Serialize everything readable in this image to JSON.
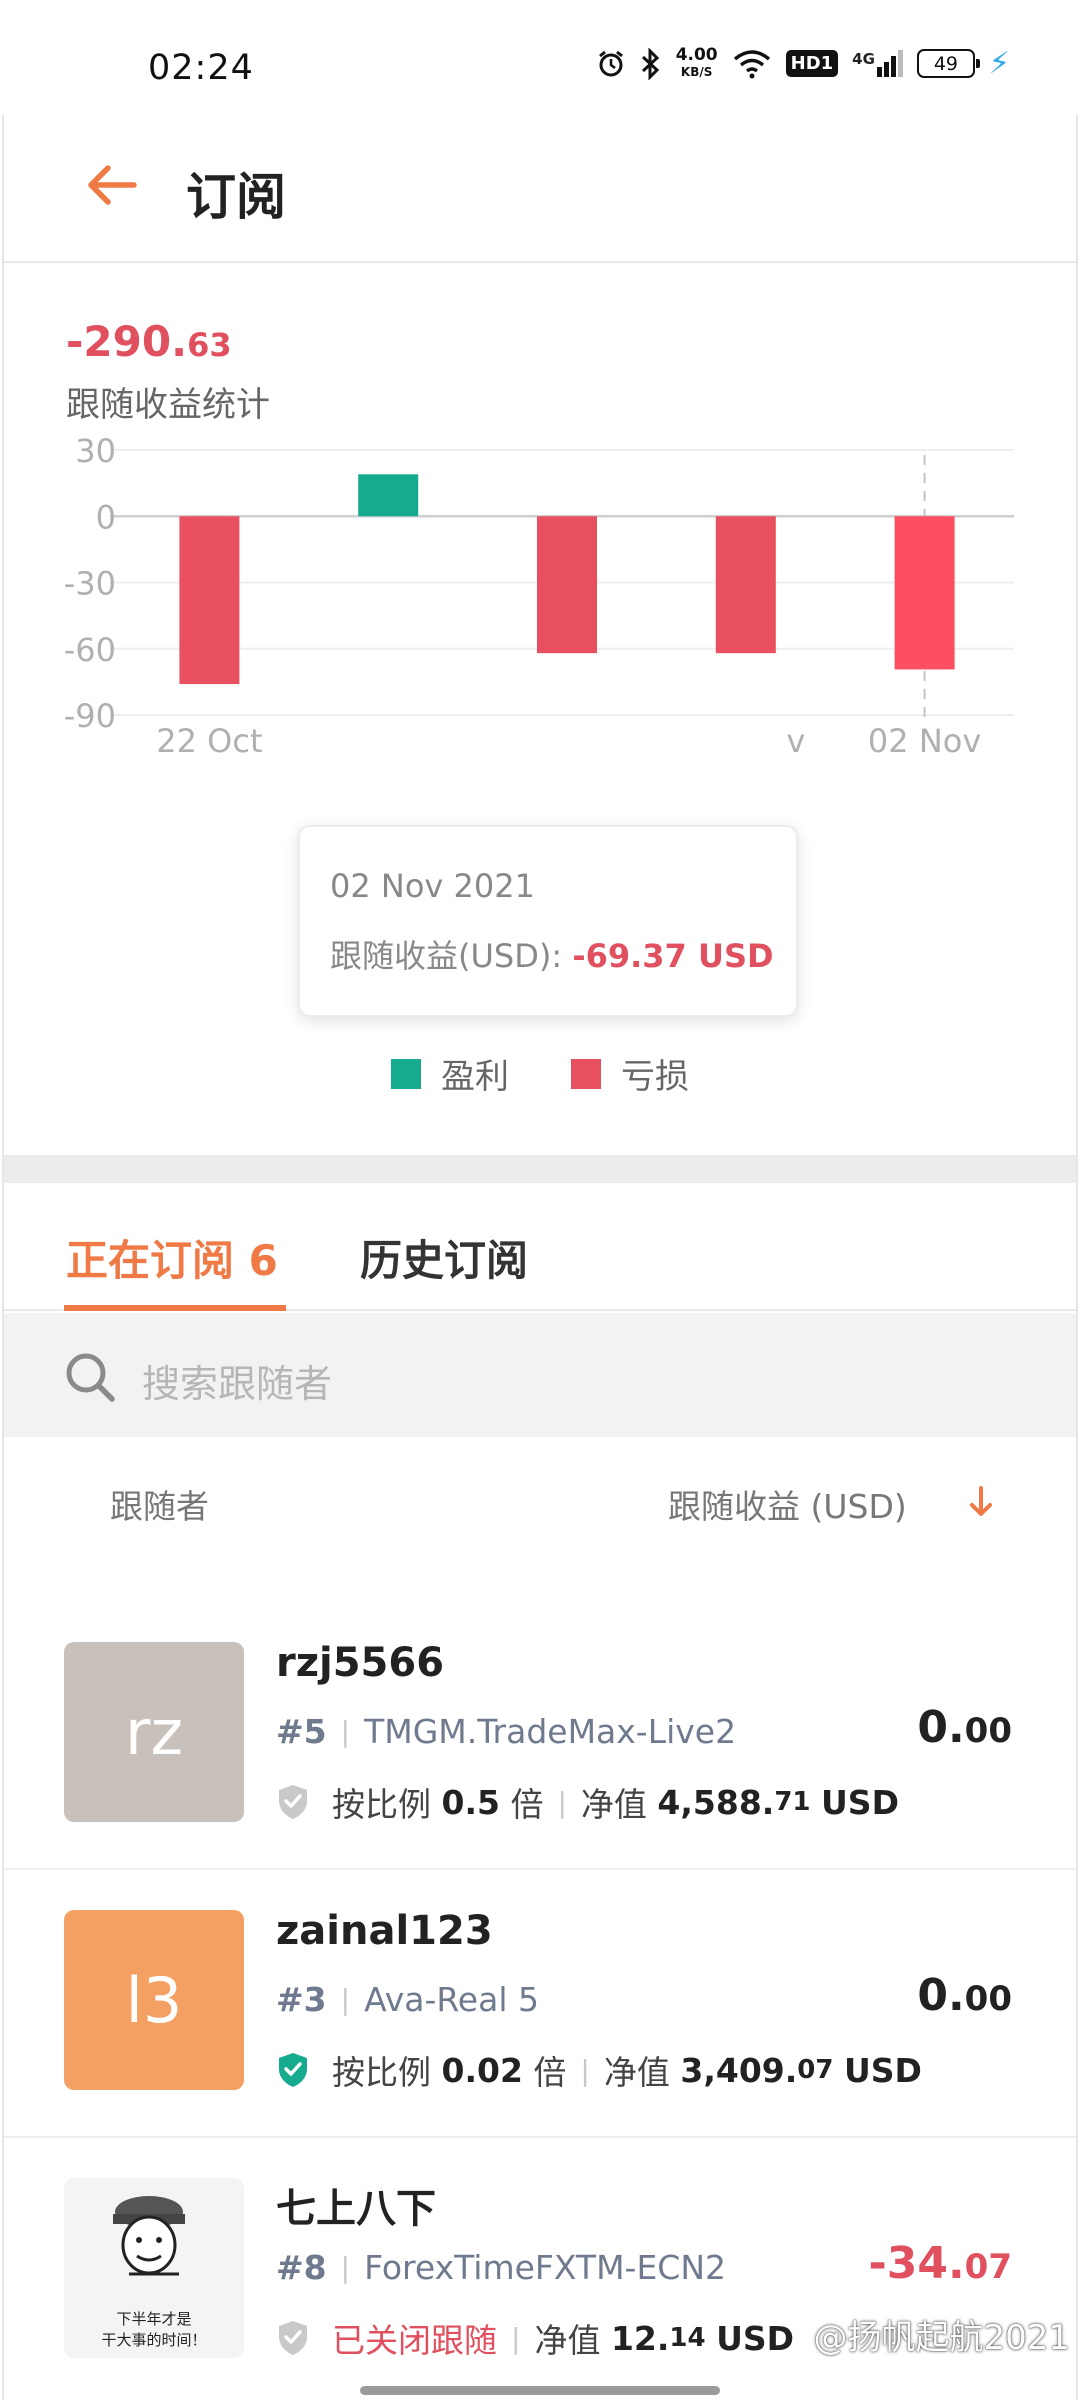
{
  "status_bar": {
    "time": "02:24",
    "network_speed_value": "4.00",
    "network_speed_unit": "KB/S",
    "hd_label": "HD1",
    "signal_label": "4G",
    "battery": "49",
    "icons": [
      "alarm-icon",
      "bluetooth-icon",
      "wifi-icon",
      "signal-icon",
      "battery-icon",
      "charging-icon"
    ]
  },
  "header": {
    "title": "订阅"
  },
  "summary": {
    "value_int": "-290.",
    "value_dec": "63",
    "label": "跟随收益统计"
  },
  "chart_data": {
    "type": "bar",
    "categories": [
      "22 Oct",
      "",
      "",
      "",
      "02 Nov"
    ],
    "values": [
      -76,
      19,
      -62,
      -62,
      -69.37
    ],
    "visible_tick_labels": [
      "22 Oct",
      "v",
      "02 Nov"
    ],
    "ylim": [
      -90,
      30
    ],
    "yticks": [
      "30",
      "0",
      "-30",
      "-60",
      "-90"
    ],
    "yvalues": [
      30,
      0,
      -30,
      -60,
      -90
    ],
    "grid": true,
    "positive_color": "#16ab8f",
    "negative_color": "#e8505f",
    "highlight_color": "#fc5062",
    "highlight_index": 4,
    "legend": [
      {
        "label": "盈利",
        "color": "#16ab8f"
      },
      {
        "label": "亏损",
        "color": "#e8505f"
      }
    ]
  },
  "tooltip": {
    "date": "02 Nov 2021",
    "label": "跟随收益(USD): ",
    "value": "-69.37 USD"
  },
  "tabs": {
    "active_label": "正在订阅 6",
    "inactive_label": "历史订阅"
  },
  "search": {
    "placeholder": "搜索跟随者"
  },
  "columns": {
    "left": "跟随者",
    "right": "跟随收益 (USD)"
  },
  "followers": [
    {
      "name": "rzj5566",
      "avatar_text": "rz",
      "avatar_color": "#c8c1bb",
      "rank": "#5",
      "server": "TMGM.TradeMax-Live2",
      "ratio_label": "按比例",
      "ratio": "0.5",
      "ratio_unit": "倍",
      "equity_label": "净值",
      "equity_int": "4,588.",
      "equity_dec": "71",
      "equity_unit": "USD",
      "profit_int": "0.",
      "profit_dec": "00",
      "shield_color": "#c9c9c9"
    },
    {
      "name": "zainal123",
      "avatar_text": "l3",
      "avatar_color": "#f3a062",
      "rank": "#3",
      "server": "Ava-Real 5",
      "ratio_label": "按比例",
      "ratio": "0.02",
      "ratio_unit": "倍",
      "equity_label": "净值",
      "equity_int": "3,409.",
      "equity_dec": "07",
      "equity_unit": "USD",
      "profit_int": "0.",
      "profit_dec": "00",
      "shield_color": "#16ab8f"
    },
    {
      "name": "七上八下",
      "avatar_caption_1": "下半年才是",
      "avatar_caption_2": "干大事的时间！",
      "rank": "#8",
      "server": "ForexTimeFXTM-ECN2",
      "status": "已关闭跟随",
      "equity_label": "净值",
      "equity_int": "12.",
      "equity_dec": "14",
      "equity_unit": "USD",
      "profit_int": "-34.",
      "profit_dec": "07",
      "shield_color": "#c9c9c9"
    }
  ],
  "watermark": "@扬帆起航2021",
  "accent_color": "#ef7a45",
  "negative_color": "#e0505f"
}
